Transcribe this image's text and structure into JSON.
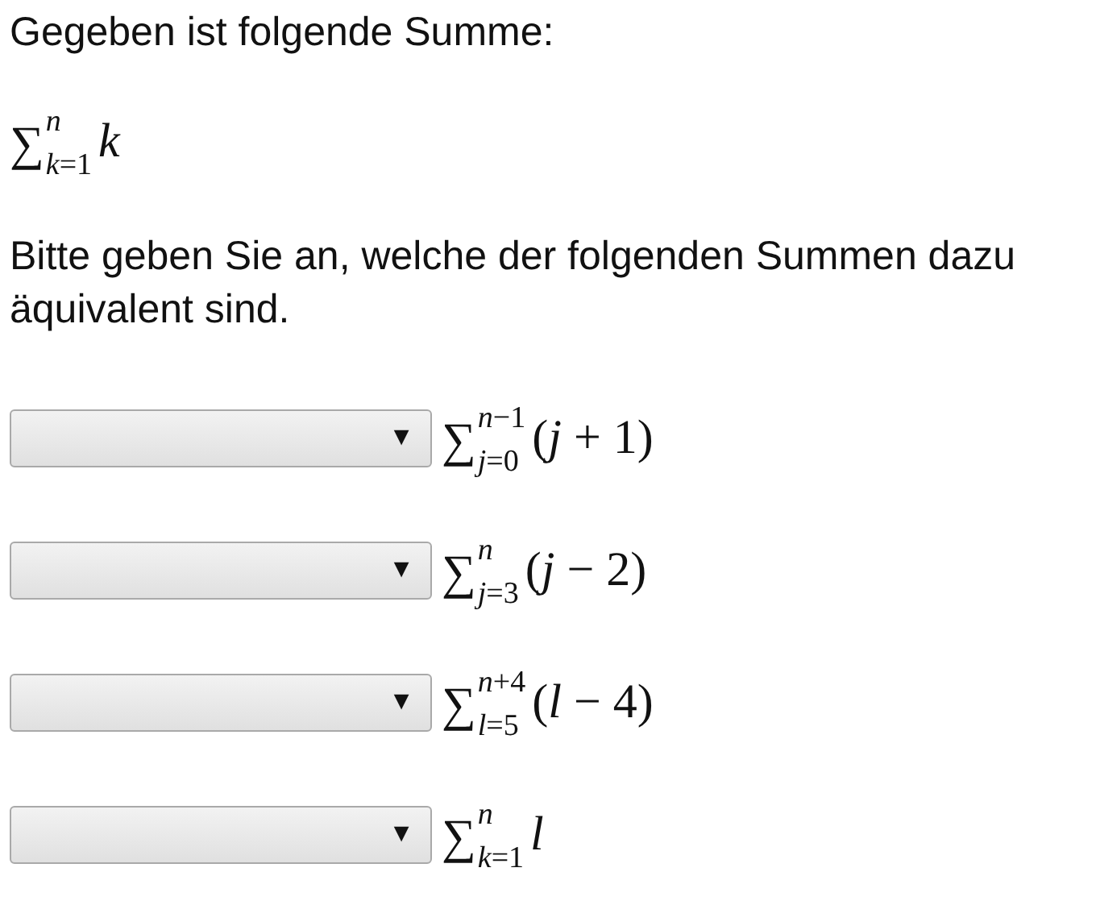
{
  "intro": "Gegeben ist folgende Summe:",
  "given": {
    "sigma": "∑",
    "upper": "*n*",
    "lower": "*k*=1",
    "body": "*k*"
  },
  "question": "Bitte geben Sie an, welche der folgenden Summen dazu äquivalent sind.",
  "options": [
    {
      "arrow": "▼",
      "formula": {
        "sigma": "∑",
        "upper": "*n*−1",
        "lower": "*j*=0",
        "body": "(*j* + 1)"
      }
    },
    {
      "arrow": "▼",
      "formula": {
        "sigma": "∑",
        "upper": "*n*",
        "lower": "*j*=3",
        "body": "(*j* − 2)"
      }
    },
    {
      "arrow": "▼",
      "formula": {
        "sigma": "∑",
        "upper": "*n*+4",
        "lower": "*l*=5",
        "body": "(*l* − 4)"
      }
    },
    {
      "arrow": "▼",
      "formula": {
        "sigma": "∑",
        "upper": "*n*",
        "lower": "*k*=1",
        "body": "*l*"
      }
    }
  ]
}
